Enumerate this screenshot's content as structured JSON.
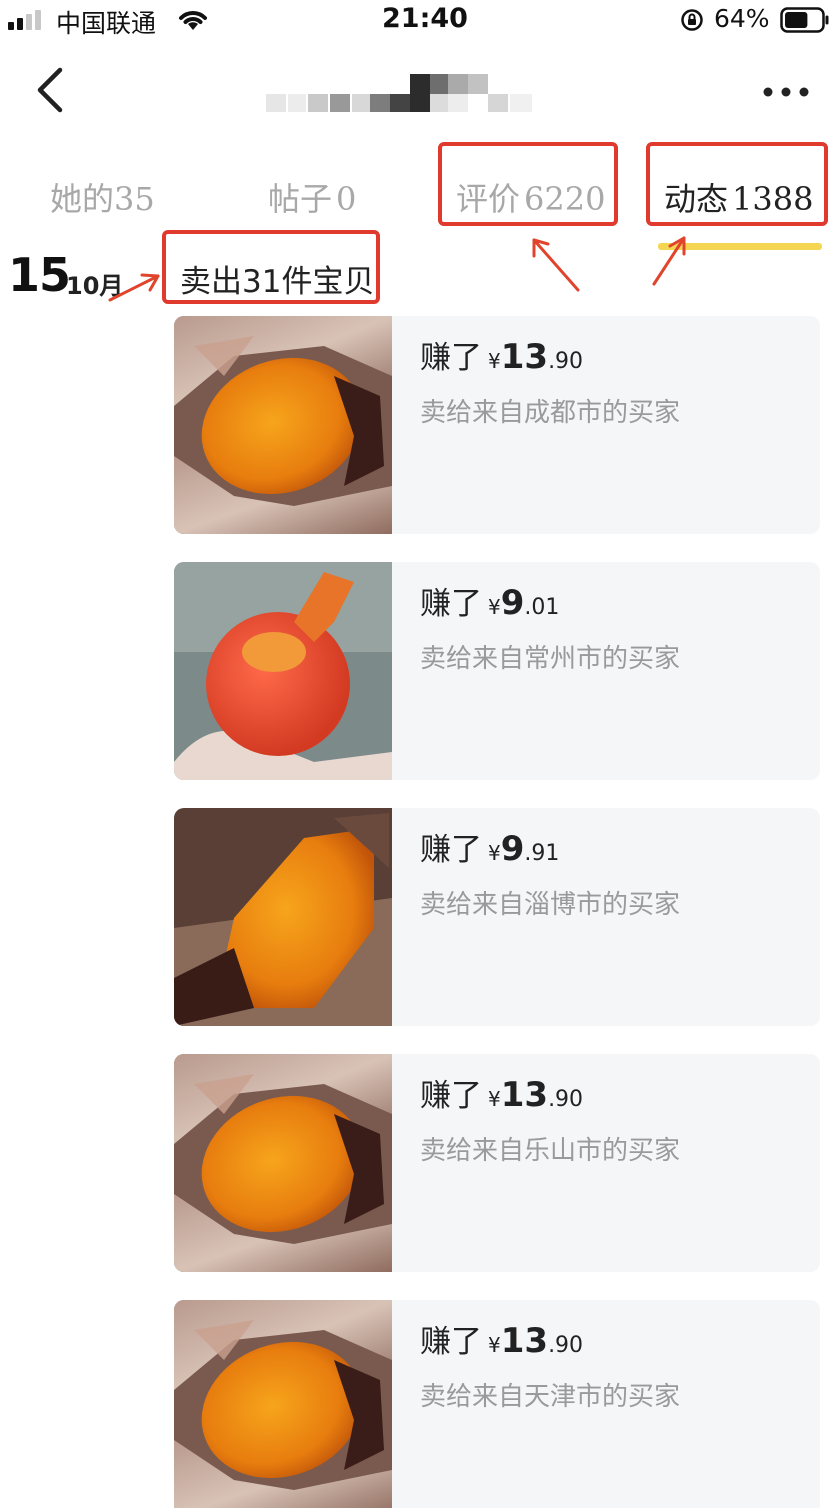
{
  "status_bar": {
    "carrier": "中国联通",
    "time": "21:40",
    "battery_percent": "64%",
    "signal_bars_filled": 2,
    "battery_level": 0.64
  },
  "nav": {
    "back_icon": "chevron-left-icon",
    "more_icon": "more-horizontal-icon"
  },
  "tabs": [
    {
      "label": "她的",
      "count": "35",
      "active": false
    },
    {
      "label": "帖子",
      "count": "0",
      "active": false
    },
    {
      "label": "评价",
      "count": "6220",
      "active": false
    },
    {
      "label": "动态",
      "count": "1388",
      "active": true
    }
  ],
  "date_group": {
    "day": "15",
    "month": "10月",
    "sold_summary": "卖出31件宝贝"
  },
  "colors": {
    "highlight": "#e03a2f",
    "tab_underline": "#f4d653",
    "card_bg": "#f5f6f8"
  },
  "sales": [
    {
      "earn_prefix": "赚了",
      "currency": "¥",
      "price_int": "13",
      "price_dec": ".90",
      "buyer": "卖给来自成都市的买家",
      "thumb": "roasted-sweet-potato-image"
    },
    {
      "earn_prefix": "赚了",
      "currency": "¥",
      "price_int": "9",
      "price_dec": ".01",
      "buyer": "卖给来自常州市的买家",
      "thumb": "peeled-sweet-potato-in-hand-image"
    },
    {
      "earn_prefix": "赚了",
      "currency": "¥",
      "price_int": "9",
      "price_dec": ".91",
      "buyer": "卖给来自淄博市的买家",
      "thumb": "broken-sweet-potato-image"
    },
    {
      "earn_prefix": "赚了",
      "currency": "¥",
      "price_int": "13",
      "price_dec": ".90",
      "buyer": "卖给来自乐山市的买家",
      "thumb": "roasted-sweet-potato-image"
    },
    {
      "earn_prefix": "赚了",
      "currency": "¥",
      "price_int": "13",
      "price_dec": ".90",
      "buyer": "卖给来自天津市的买家",
      "thumb": "roasted-sweet-potato-image"
    }
  ]
}
